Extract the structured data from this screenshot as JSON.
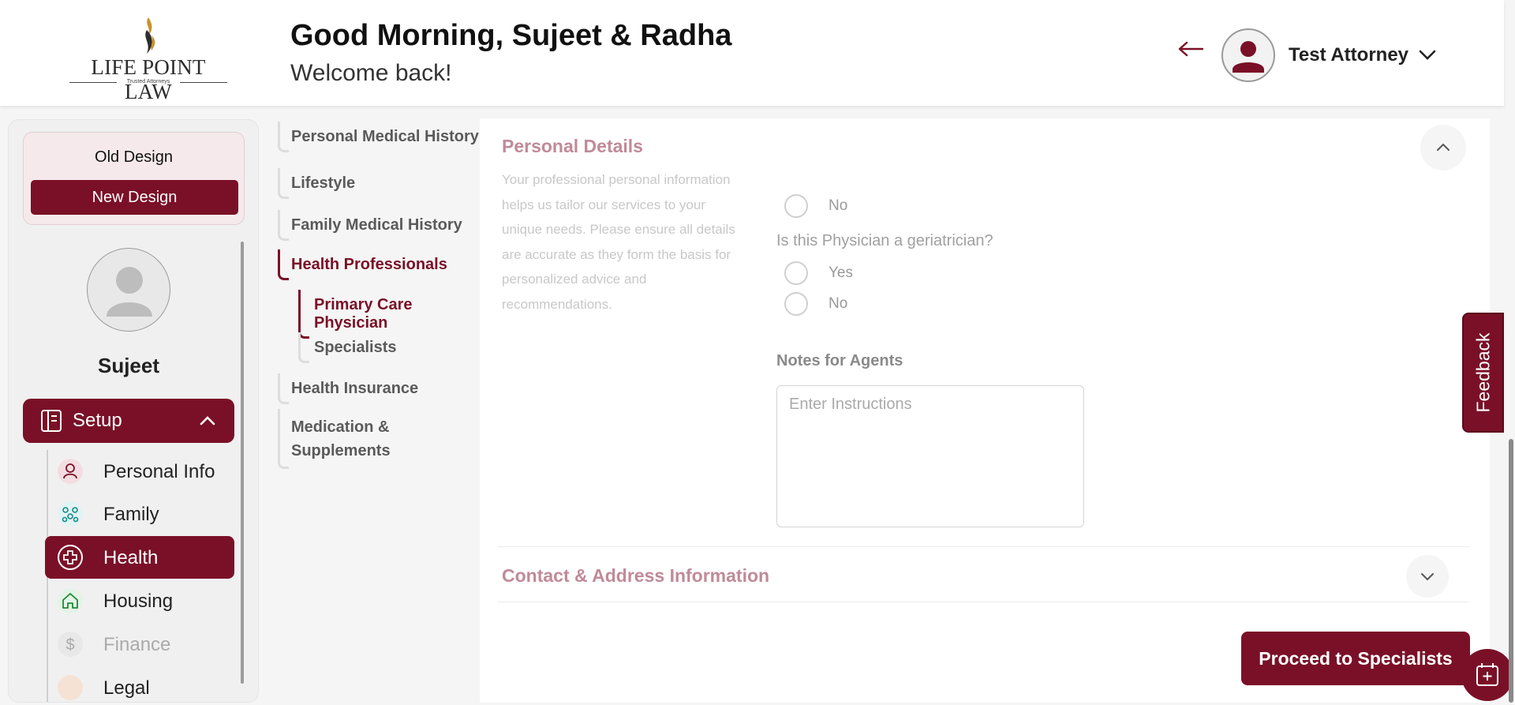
{
  "header": {
    "logo_text": "LIFE POINT LAW",
    "logo_tagline": "Trusted Attorneys",
    "greeting": "Good Morning, Sujeet & Radha",
    "subtitle": "Welcome back!",
    "user_name": "Test Attorney"
  },
  "sidebar": {
    "old_design": "Old Design",
    "new_design": "New Design",
    "profile_name": "Sujeet",
    "setup_label": "Setup",
    "items": [
      {
        "label": "Personal Info",
        "icon": "person-icon"
      },
      {
        "label": "Family",
        "icon": "family-icon"
      },
      {
        "label": "Health",
        "icon": "health-cross-icon"
      },
      {
        "label": "Housing",
        "icon": "home-icon"
      },
      {
        "label": "Finance",
        "icon": "dollar-icon"
      },
      {
        "label": "Legal",
        "icon": "legal-icon"
      }
    ]
  },
  "section_nav": {
    "items": [
      "Personal Medical History",
      "Lifestyle",
      "Family Medical History",
      "Health Professionals",
      "Primary Care Physician",
      "Specialists",
      "Health Insurance",
      "Medication &",
      "Supplements"
    ]
  },
  "main": {
    "personal_details_title": "Personal Details",
    "personal_details_desc": "Your professional personal information helps us tailor our services to your unique needs. Please ensure all details are accurate as they form the basis for personalized advice and recommendations.",
    "radio_yes": "Yes",
    "radio_no": "No",
    "geriatrician_question": "Is this Physician a geriatrician?",
    "notes_label": "Notes for Agents",
    "notes_placeholder": "Enter Instructions",
    "contact_title": "Contact & Address Information",
    "proceed_button": "Proceed to Specialists",
    "feedback": "Feedback"
  },
  "colors": {
    "brand": "#7a1027",
    "muted_title": "#c08a98"
  }
}
